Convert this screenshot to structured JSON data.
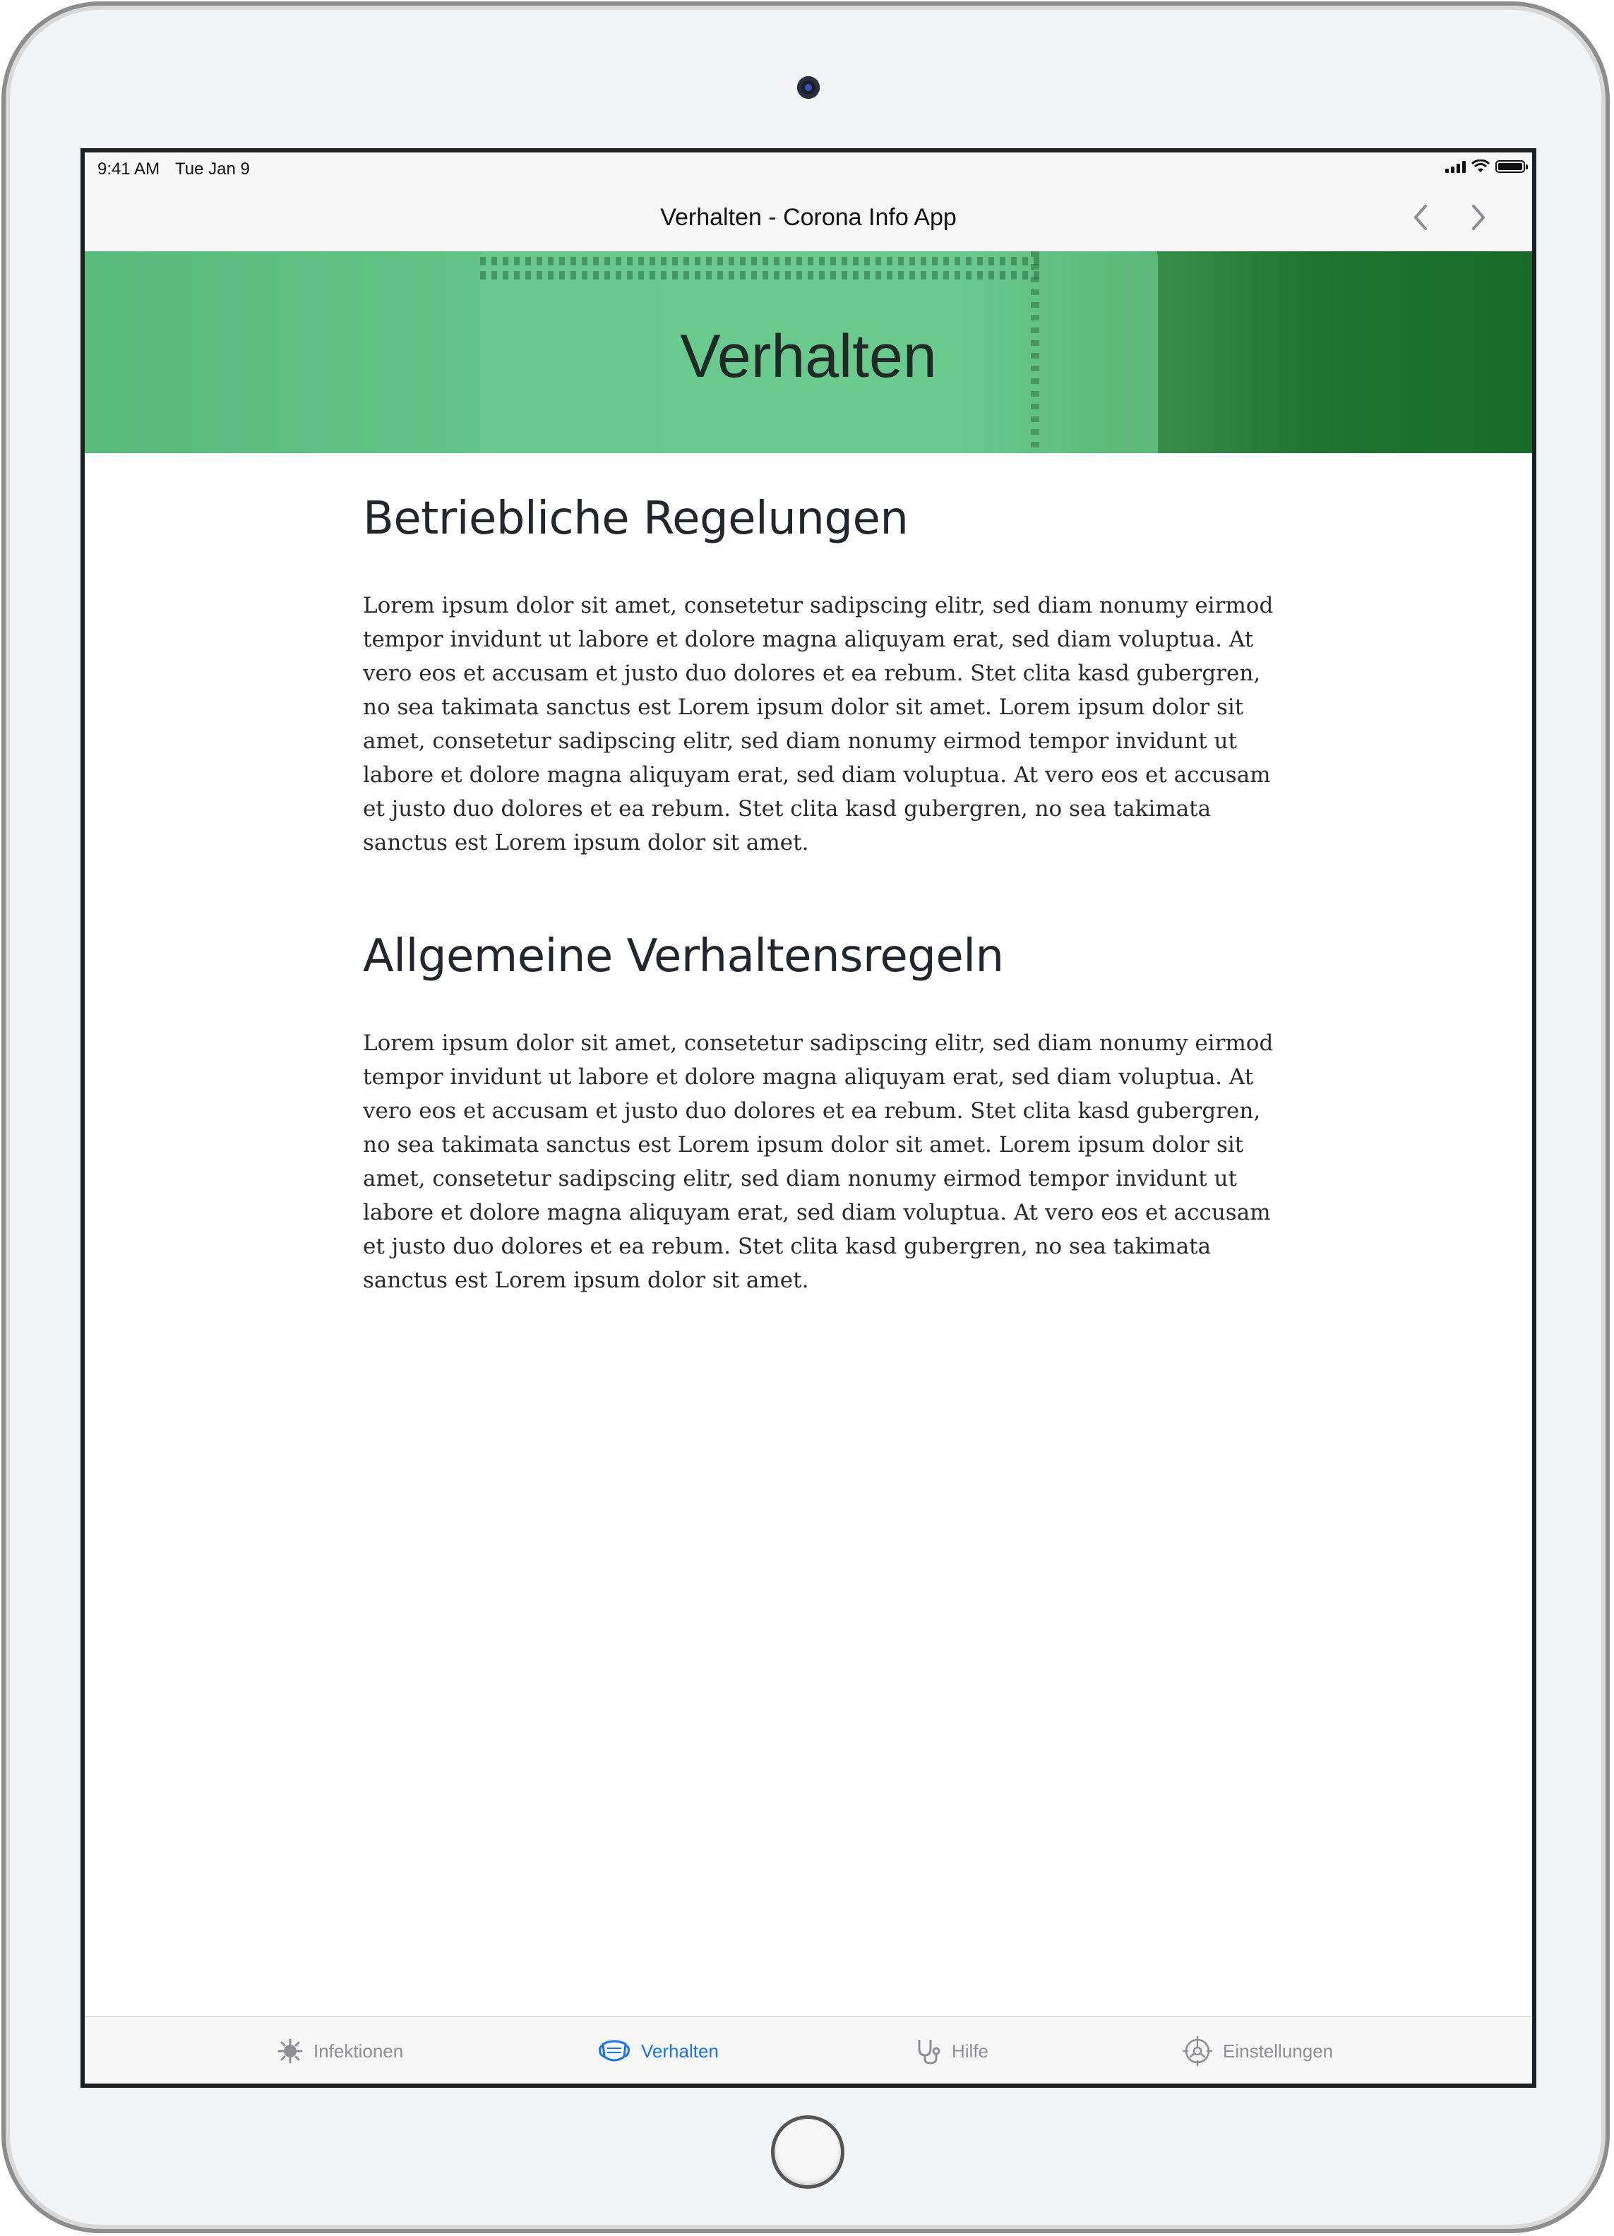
{
  "status_bar": {
    "time": "9:41 AM",
    "date": "Tue Jan 9"
  },
  "nav": {
    "title": "Verhalten - Corona Info App",
    "back_icon": "chevron-left-icon",
    "forward_icon": "chevron-right-icon"
  },
  "hero": {
    "title": "Verhalten",
    "background_color": "#5fbf82"
  },
  "sections": [
    {
      "title": "Betriebliche Regelungen",
      "text": "Lorem ipsum dolor sit amet, consetetur sadipscing elitr, sed diam nonumy eirmod tempor invidunt ut labore et dolore magna aliquyam erat, sed diam voluptua. At vero eos et accusam et justo duo dolores et ea rebum. Stet clita kasd gubergren, no sea takimata sanctus est Lorem ipsum dolor sit amet. Lorem ipsum dolor sit amet, consetetur sadipscing elitr, sed diam nonumy eirmod tempor invidunt ut labore et dolore magna aliquyam erat, sed diam voluptua. At vero eos et accusam et justo duo dolores et ea rebum. Stet clita kasd gubergren, no sea takimata sanctus est Lorem ipsum dolor sit amet."
    },
    {
      "title": "Allgemeine Verhaltensregeln",
      "text": "Lorem ipsum dolor sit amet, consetetur sadipscing elitr, sed diam nonumy eirmod tempor invidunt ut labore et dolore magna aliquyam erat, sed diam voluptua. At vero eos et accusam et justo duo dolores et ea rebum. Stet clita kasd gubergren, no sea takimata sanctus est Lorem ipsum dolor sit amet. Lorem ipsum dolor sit amet, consetetur sadipscing elitr, sed diam nonumy eirmod tempor invidunt ut labore et dolore magna aliquyam erat, sed diam voluptua. At vero eos et accusam et justo duo dolores et ea rebum. Stet clita kasd gubergren, no sea takimata sanctus est Lorem ipsum dolor sit amet."
    }
  ],
  "tab_bar": {
    "active_color": "#1a73e8",
    "inactive_color": "#8e8e93",
    "tabs": [
      {
        "label": "Infektionen",
        "icon": "virus-icon",
        "active": false
      },
      {
        "label": "Verhalten",
        "icon": "face-mask-icon",
        "active": true
      },
      {
        "label": "Hilfe",
        "icon": "stethoscope-icon",
        "active": false
      },
      {
        "label": "Einstellungen",
        "icon": "gear-icon",
        "active": false
      }
    ]
  }
}
